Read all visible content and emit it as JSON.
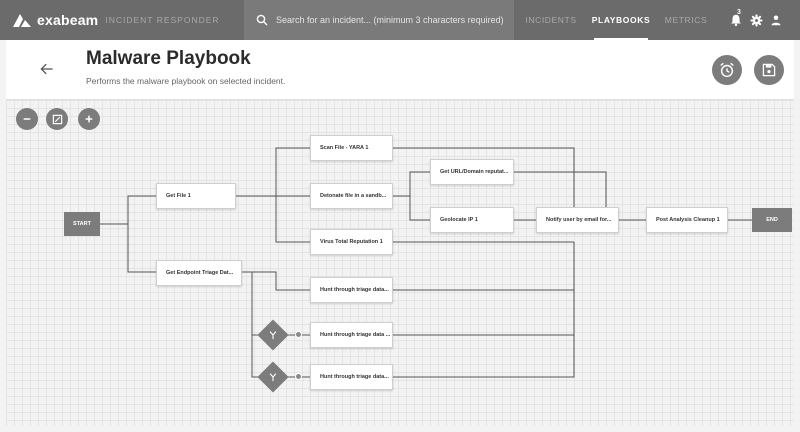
{
  "topbar": {
    "brand": "exabeam",
    "product": "INCIDENT RESPONDER",
    "search_placeholder": "Search for an incident... (minimum 3 characters required)",
    "tabs": [
      "INCIDENTS",
      "PLAYBOOKS",
      "METRICS"
    ],
    "active_tab": "PLAYBOOKS",
    "notification_count": "3",
    "icons": [
      "exabeam-logo-icon",
      "search-icon",
      "bell-icon",
      "gear-icon",
      "user-icon"
    ]
  },
  "header": {
    "title": "Malware Playbook",
    "subtitle": "Performs the malware playbook on selected incident.",
    "icons": [
      "back-arrow-icon",
      "alarm-clock-icon",
      "save-icon"
    ]
  },
  "canvas_controls": {
    "icons": [
      "zoom-out-icon",
      "fit-to-screen-icon",
      "zoom-in-icon"
    ]
  },
  "flow": {
    "start": "START",
    "end": "END",
    "nodes": {
      "get_file": "Get File 1",
      "get_endpoint": "Get Endpoint Triage Dat...",
      "scan_file": "Scan File - YARA 1",
      "detonate": "Detonate file in a sandb...",
      "virus_total": "Virus Total Reputation 1",
      "get_url": "Get URL/Domain reputat...",
      "geolocate": "Geolocate IP 1",
      "notify": "Notify user by email for...",
      "post_analysis": "Post Analysis Cleanup 1",
      "hunt_1": "Hunt through triage data...",
      "hunt_2": "Hunt through triage data ...",
      "hunt_3": "Hunt through triage data..."
    },
    "decision_icon": "branch-icon"
  },
  "colors": {
    "topbar": "#6b6b6b",
    "accent_gray": "#7c7c7c",
    "canvas": "#f3f3f3",
    "edge": "#555555"
  }
}
